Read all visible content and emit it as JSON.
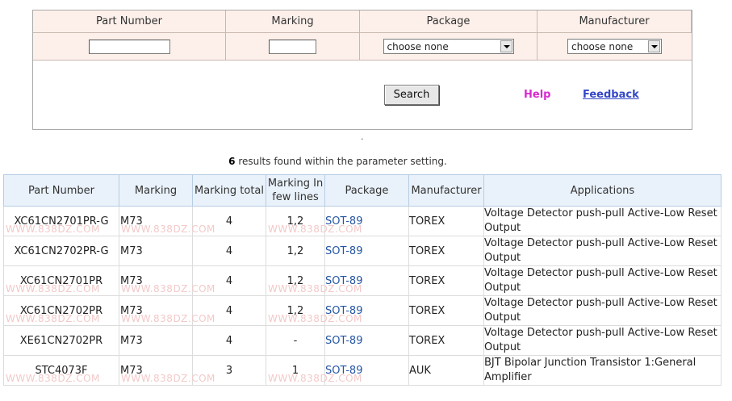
{
  "form": {
    "headers": [
      "Part Number",
      "Marking",
      "Package",
      "Manufacturer"
    ],
    "part_number_value": "",
    "marking_value": "",
    "package_select": "choose none",
    "manufacturer_select": "choose none",
    "search_label": "Search",
    "help_label": "Help",
    "feedback_label": "Feedback"
  },
  "separator": ".",
  "summary": {
    "count": "6",
    "text": " results found within the parameter setting."
  },
  "watermark": "WWW.838DZ.COM",
  "table": {
    "columns": [
      "Part Number",
      "Marking",
      "Marking total",
      "Marking In few lines",
      "Package",
      "Manufacturer",
      "Applications"
    ],
    "rows": [
      {
        "part": "XC61CN2701PR-G",
        "marking": "M73",
        "total": "4",
        "lines": "1,2",
        "package": "SOT-89",
        "manufacturer": "TOREX",
        "application": "Voltage Detector  push-pull Active-Low Reset Output"
      },
      {
        "part": "XC61CN2702PR-G",
        "marking": "M73",
        "total": "4",
        "lines": "1,2",
        "package": "SOT-89",
        "manufacturer": "TOREX",
        "application": "Voltage Detector  push-pull Active-Low Reset Output"
      },
      {
        "part": "XC61CN2701PR",
        "marking": "M73",
        "total": "4",
        "lines": "1,2",
        "package": "SOT-89",
        "manufacturer": "TOREX",
        "application": "Voltage Detector  push-pull Active-Low Reset Output"
      },
      {
        "part": "XC61CN2702PR",
        "marking": "M73",
        "total": "4",
        "lines": "1,2",
        "package": "SOT-89",
        "manufacturer": "TOREX",
        "application": "Voltage Detector  push-pull Active-Low Reset Output"
      },
      {
        "part": "XE61CN2702PR",
        "marking": "M73",
        "total": "4",
        "lines": "-",
        "package": "SOT-89",
        "manufacturer": "TOREX",
        "application": "Voltage Detector  push-pull Active-Low Reset Output"
      },
      {
        "part": "STC4073F",
        "marking": "M73",
        "total": "3",
        "lines": "1",
        "package": "SOT-89",
        "manufacturer": "AUK",
        "application": "BJT Bipolar Junction Transistor  1:General Amplifier"
      }
    ]
  }
}
